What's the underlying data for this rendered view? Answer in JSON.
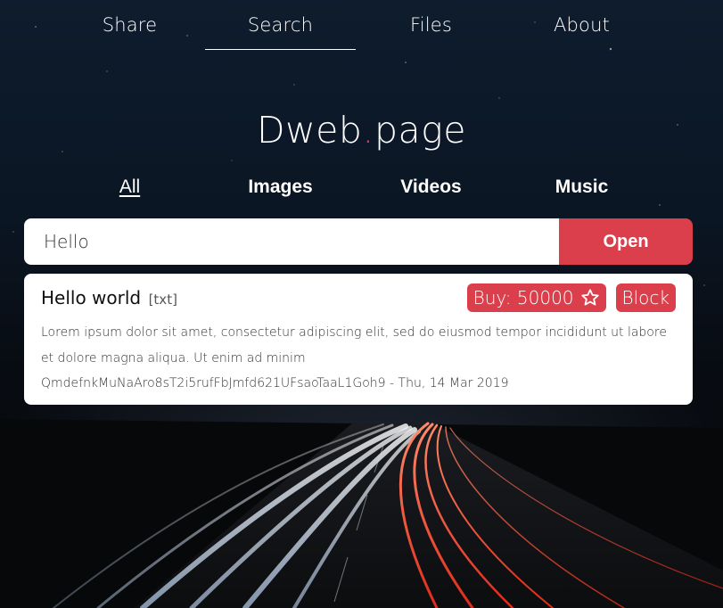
{
  "nav": {
    "items": [
      {
        "label": "Share"
      },
      {
        "label": "Search"
      },
      {
        "label": "Files"
      },
      {
        "label": "About"
      }
    ],
    "active": "Search"
  },
  "logo": {
    "part1": "Dweb",
    "dot": ".",
    "part2": "page"
  },
  "categories": [
    {
      "label": "All"
    },
    {
      "label": "Images"
    },
    {
      "label": "Videos"
    },
    {
      "label": "Music"
    }
  ],
  "search": {
    "value": "Hello",
    "button_label": "Open"
  },
  "result": {
    "title": "Hello world",
    "type": "[txt]",
    "buy_label": "Buy: 50000",
    "block_label": "Block",
    "description": "Lorem ipsum dolor sit amet, consectetur adipiscing elit, sed do eiusmod tempor incididunt ut labore et dolore magna aliqua. Ut enim ad minim",
    "meta": "QmdefnkMuNaAro8sT2i5rufFbJmfd621UFsaoTaaL1Goh9 - Thu, 14 Mar 2019"
  },
  "colors": {
    "accent": "#dc3f4c",
    "card_bg": "#ffffff",
    "text": "#ffffff"
  },
  "icons": {
    "star": "star-outline-icon"
  }
}
